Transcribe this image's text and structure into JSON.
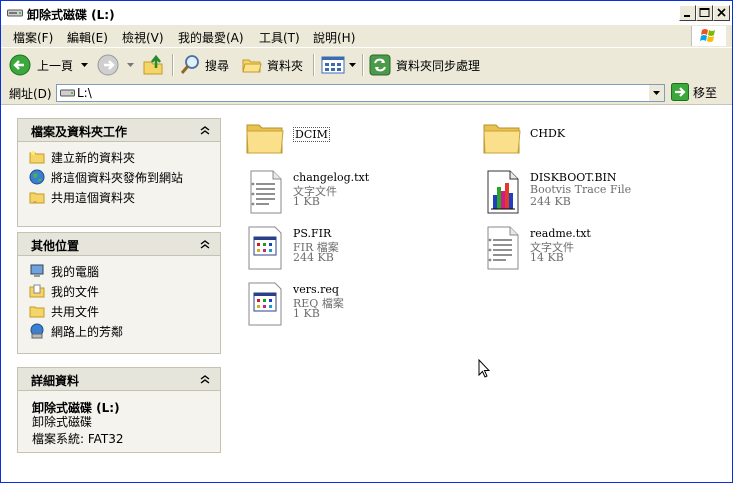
{
  "window": {
    "title": "卸除式磁碟 (L:)"
  },
  "menu": [
    "檔案(F)",
    "編輯(E)",
    "檢視(V)",
    "我的最愛(A)",
    "工具(T)",
    "說明(H)"
  ],
  "toolbar": {
    "back_label": "上一頁",
    "search_label": "搜尋",
    "folders_label": "資料夾",
    "sync_label": "資料夾同步處理"
  },
  "address": {
    "label": "網址(D)",
    "value": "L:\\",
    "go_label": "移至"
  },
  "panels": {
    "tasks": {
      "title": "檔案及資料夾工作",
      "items": [
        "建立新的資料夾",
        "將這個資料夾發佈到網站",
        "共用這個資料夾"
      ]
    },
    "places": {
      "title": "其他位置",
      "items": [
        "我的電腦",
        "我的文件",
        "共用文件",
        "網路上的芳鄰"
      ]
    },
    "details": {
      "title": "詳細資料",
      "name": "卸除式磁碟 (L:)",
      "type": "卸除式磁碟",
      "fs": "檔案系統: FAT32"
    }
  },
  "files": [
    {
      "name": "DCIM",
      "type": "",
      "size": "",
      "icon": "folder-icon"
    },
    {
      "name": "CHDK",
      "type": "",
      "size": "",
      "icon": "folder-icon"
    },
    {
      "name": "changelog.txt",
      "type": "文字文件",
      "size": "1 KB",
      "icon": "text-file-icon"
    },
    {
      "name": "DISKBOOT.BIN",
      "type": "Bootvis Trace File",
      "size": "244 KB",
      "icon": "trace-file-icon"
    },
    {
      "name": "PS.FIR",
      "type": "FIR 檔案",
      "size": "244 KB",
      "icon": "binary-file-icon"
    },
    {
      "name": "readme.txt",
      "type": "文字文件",
      "size": "14 KB",
      "icon": "text-file-icon"
    },
    {
      "name": "vers.req",
      "type": "REQ 檔案",
      "size": "1 KB",
      "icon": "binary-file-icon"
    }
  ]
}
